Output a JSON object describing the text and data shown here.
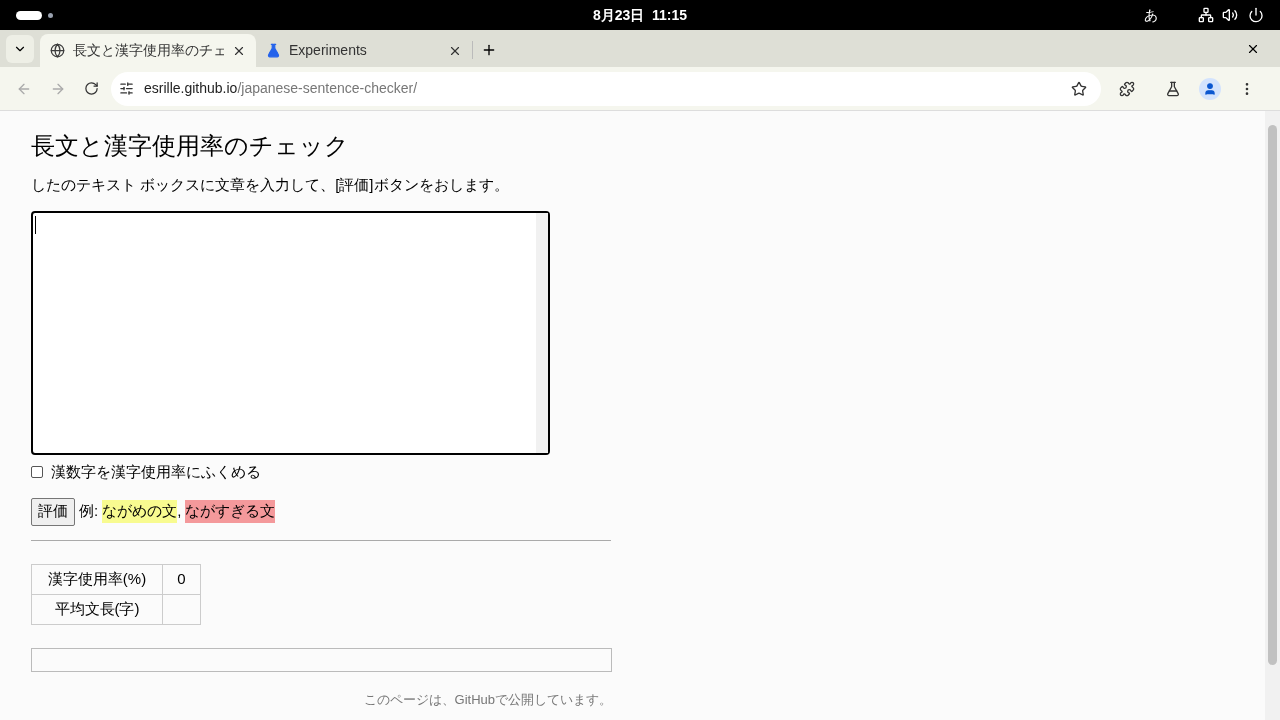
{
  "system_bar": {
    "clock": "8月23日  11:15",
    "input_method": "あ"
  },
  "tabs": [
    {
      "title": "長文と漢字使用率のチェ",
      "selected": true,
      "kind": "globe"
    },
    {
      "title": "Experiments",
      "selected": false,
      "kind": "flask"
    }
  ],
  "address_bar": {
    "host": "esrille.github.io",
    "path": "/japanese-sentence-checker/"
  },
  "page": {
    "heading": "長文と漢字使用率のチェック",
    "instruction": "したのテキスト ボックスに文章を入力して、[評価]ボタンをおします。",
    "checkbox": {
      "label": "漢数字を漢字使用率にふくめる",
      "checked": false
    },
    "evaluate_button": "評価",
    "example_label": "例:",
    "examples": [
      {
        "text": "ながめの文",
        "color": "#f8fb90"
      },
      {
        "text": "ながすぎる文",
        "color": "#f4999b"
      }
    ],
    "example_separator": ",",
    "results": [
      {
        "label": "漢字使用率(%)",
        "value": "0"
      },
      {
        "label": "平均文長(字)"
      }
    ],
    "footer": "このページは、GitHubで公開しています。"
  }
}
